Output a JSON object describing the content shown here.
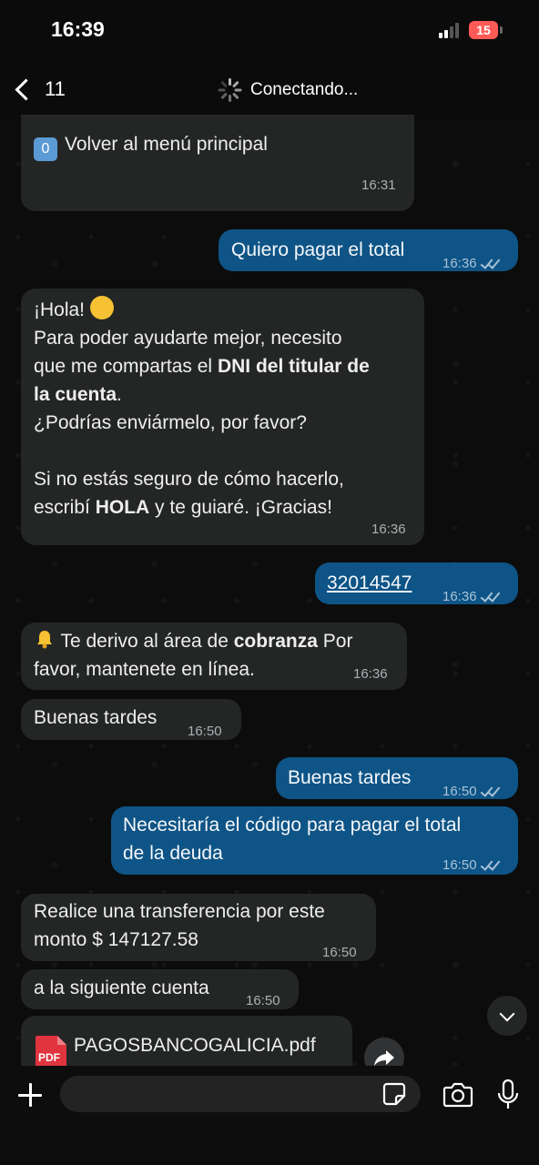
{
  "status": {
    "time": "16:39",
    "battery": "15"
  },
  "header": {
    "back_count": "11",
    "connecting": "Conectando..."
  },
  "messages": {
    "m1": {
      "text": "Volver al menú principal",
      "keycap": "0",
      "time": "16:31"
    },
    "m2": {
      "text": "Quiero pagar el total",
      "time": "16:36"
    },
    "m3": {
      "l1": "¡Hola!",
      "l2": "Para poder ayudarte mejor, necesito",
      "l3a": "que me compartas el ",
      "l3b": "DNI del titular de",
      "l4a": "la cuenta",
      "l4b": ".",
      "l5": "¿Podrías enviármelo, por favor?",
      "l6": "Si no estás seguro de cómo hacerlo,",
      "l7a": "escribí ",
      "l7b": "HOLA",
      "l7c": " y te guiaré. ¡Gracias!",
      "time": "16:36"
    },
    "m4": {
      "text": "32014547",
      "time": "16:36"
    },
    "m5": {
      "l1a": " Te derivo al área de ",
      "l1b": "cobranza",
      "l1c": " Por",
      "l2": "favor, mantenete en línea.",
      "time": "16:36"
    },
    "m6": {
      "text": "Buenas tardes",
      "time": "16:50"
    },
    "m7": {
      "text": "Buenas tardes",
      "time": "16:50"
    },
    "m8": {
      "l1": "Necesitaría el código para pagar el total",
      "l2": "de la deuda",
      "time": "16:50"
    },
    "m9": {
      "l1": "Realice una transferencia por este",
      "l2": "monto $ 147127.58",
      "time": "16:50"
    },
    "m10": {
      "text": "a la siguiente cuenta",
      "time": "16:50"
    },
    "m11": {
      "filename": "PAGOSBANCOGALICIA.pdf",
      "badge": "PDF"
    }
  },
  "colors": {
    "incoming": "#242626",
    "outgoing": "#0e5486",
    "background": "#0b0b0b"
  },
  "icons": [
    "back-chevron-icon",
    "spinner-icon",
    "scroll-down-icon",
    "forward-icon",
    "plus-icon",
    "sticker-icon",
    "camera-icon",
    "mic-icon"
  ]
}
